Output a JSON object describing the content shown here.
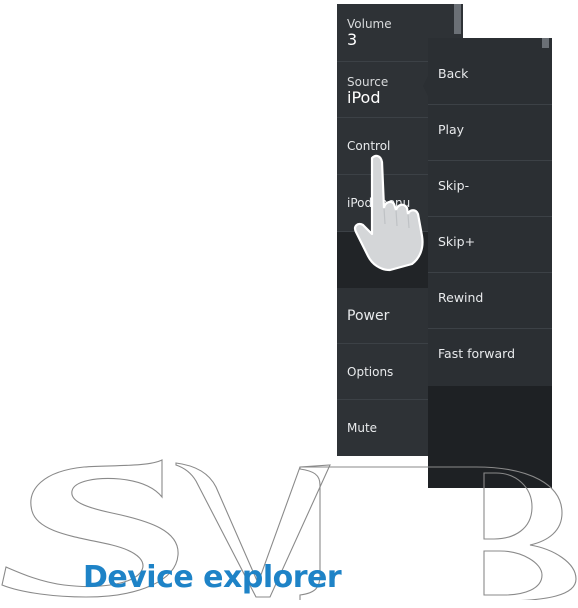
{
  "main_menu": {
    "volume": {
      "label": "Volume",
      "value": "3"
    },
    "source": {
      "label": "Source",
      "value": "iPod"
    },
    "control": {
      "label": "Control"
    },
    "ipod_menu": {
      "label": "iPod menu"
    },
    "power": {
      "label": "Power"
    },
    "options": {
      "label": "Options"
    },
    "mute": {
      "label": "Mute"
    }
  },
  "control_submenu": {
    "items": [
      "Back",
      "Play",
      "Skip-",
      "Skip+",
      "Rewind",
      "Fast forward"
    ]
  },
  "watermark": {
    "text": "SVB"
  },
  "section_title": "Device explorer",
  "colors": {
    "panel": "#2e3236",
    "submenu": "#2b2f33",
    "title_blue": "#1e83c7"
  },
  "icons": [
    "pointing-hand-icon"
  ]
}
